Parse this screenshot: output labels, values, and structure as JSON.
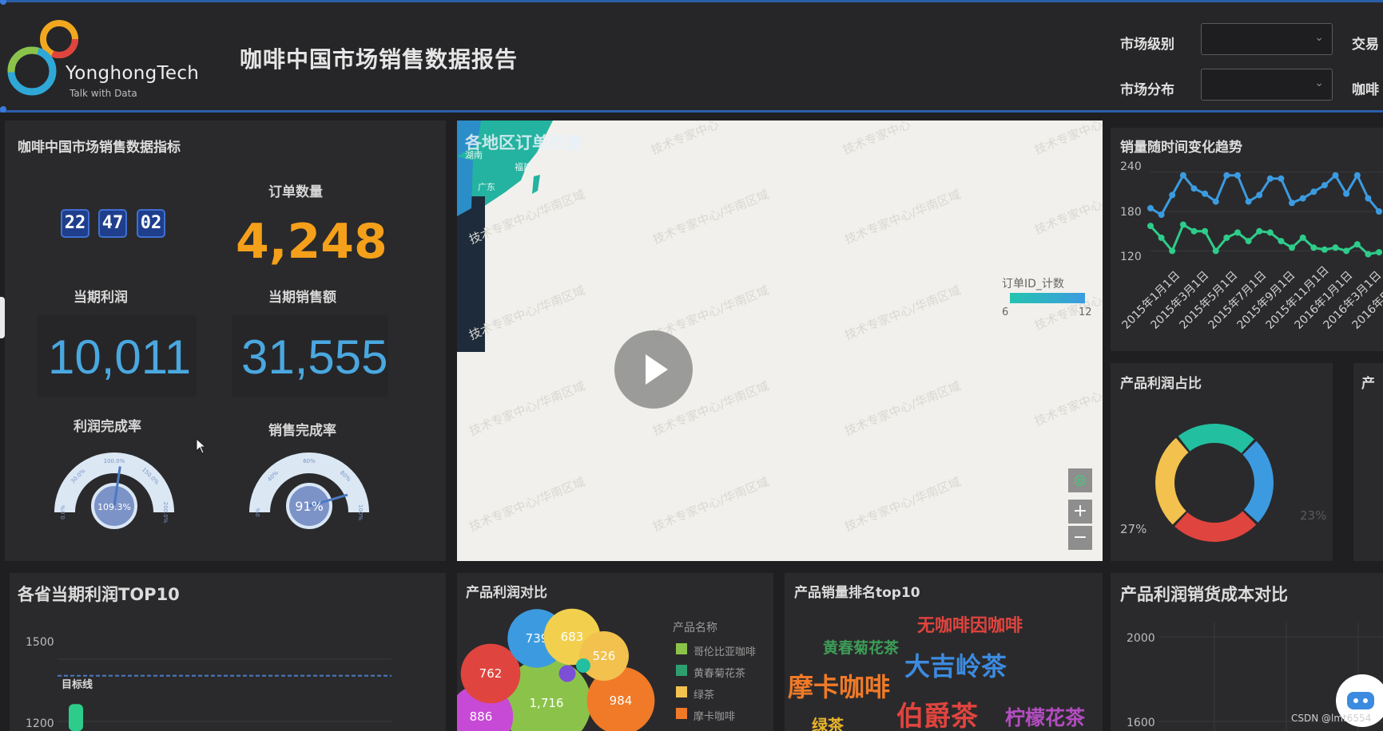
{
  "header": {
    "brand": "YonghongTech",
    "brand_tagline": "Talk with Data",
    "report_title": "咖啡中国市场销售数据报告",
    "filters": [
      {
        "label": "市场级别",
        "value": ""
      },
      {
        "label": "市场分布",
        "value": ""
      }
    ],
    "cut_labels": [
      "交易",
      "咖啡"
    ]
  },
  "kpi_panel": {
    "title": "咖啡中国市场销售数据指标",
    "clock": [
      "22",
      "47",
      "02"
    ],
    "order_count_label": "订单数量",
    "order_count": "4,248",
    "profit_label": "当期利润",
    "profit": "10,011",
    "sales_label": "当期销售额",
    "sales": "31,555",
    "profit_rate_label": "利润完成率",
    "profit_rate": "109.3%",
    "profit_rate_value": 109.3,
    "profit_gauge_ticks": [
      "0.0%",
      "30.0%",
      "100.0%",
      "150.0%",
      "200.0%"
    ],
    "sales_rate_label": "销售完成率",
    "sales_rate": "91%",
    "sales_rate_value": 91,
    "sales_gauge_ticks": [
      "0%",
      "40%",
      "60%",
      "80%",
      "100%"
    ]
  },
  "map_panel": {
    "title": "各地区订单数量",
    "watermark": "技术专家中心/华南区域",
    "watermark_short": "技术专家中心",
    "legend_title": "订单ID_计数",
    "legend_min": "6",
    "legend_max": "12",
    "province_labels": [
      "湖南",
      "广东",
      "福建"
    ],
    "controls": {
      "locate": "◎",
      "zoom_in": "+",
      "zoom_out": "−"
    }
  },
  "trend_panel": {
    "title": "销量随时间变化趋势",
    "y_ticks": [
      "240",
      "180",
      "120"
    ],
    "x_ticks": [
      "2015年1月1日",
      "2015年3月1日",
      "2015年5月1日",
      "2015年7月1日",
      "2015年9月1日",
      "2015年11月1日",
      "2016年1月1日",
      "2016年3月1日",
      "2016年5"
    ]
  },
  "share_panel": {
    "title": "产品利润占比",
    "label_left": "27%",
    "label_right": "23%",
    "next_title": "产"
  },
  "province_panel": {
    "title": "各省当期利润TOP10",
    "y_ticks": [
      "1500",
      "1200"
    ],
    "target_label": "目标线"
  },
  "bubble_panel": {
    "title": "产品利润对比",
    "legend_title": "产品名称",
    "legend": [
      {
        "name": "哥伦比亚咖啡",
        "color": "#8bc34a"
      },
      {
        "name": "黄春菊花茶",
        "color": "#2e9e6e"
      },
      {
        "name": "绿茶",
        "color": "#f2c14e"
      },
      {
        "name": "摩卡咖啡",
        "color": "#f07a28"
      }
    ]
  },
  "wordcloud_panel": {
    "title": "产品销量排名top10",
    "words": [
      {
        "text": "无咖啡因咖啡",
        "color": "#e0443e"
      },
      {
        "text": "黄春菊花茶",
        "color": "#3d9e58"
      },
      {
        "text": "大吉岭茶",
        "color": "#3c8be0"
      },
      {
        "text": "摩卡咖啡",
        "color": "#f07a28"
      },
      {
        "text": "伯爵茶",
        "color": "#e0443e"
      },
      {
        "text": "柠檬花茶",
        "color": "#b24dbf"
      },
      {
        "text": "绿茶",
        "color": "#e8b52c"
      }
    ]
  },
  "cost_panel": {
    "title": "产品利润销货成本对比",
    "y_ticks": [
      "2000",
      "1600"
    ]
  },
  "footer": {
    "credit": "CSDN @lmt6554"
  },
  "chart_data": [
    {
      "type": "line",
      "title": "销量随时间变化趋势",
      "ylim": [
        95,
        265
      ],
      "grid": true,
      "x": [
        "2015年1月1日",
        "",
        "2015年3月1日",
        "",
        "2015年5月1日",
        "",
        "2015年7月1日",
        "",
        "2015年9月1日",
        "",
        "2015年11月1日",
        "",
        "2016年1月1日",
        "",
        "2016年3月1日",
        "",
        "2016年5",
        "",
        "",
        "",
        "",
        ""
      ],
      "series": [
        {
          "values": [
            185,
            175,
            205,
            235,
            215,
            207,
            195,
            235,
            235,
            195,
            205,
            230,
            230,
            193,
            200,
            210,
            220,
            235,
            207,
            235,
            200,
            180
          ],
          "color": "#3c9be0"
        },
        {
          "values": [
            158,
            140,
            120,
            160,
            150,
            150,
            120,
            140,
            148,
            135,
            150,
            148,
            135,
            125,
            140,
            125,
            122,
            125,
            120,
            130,
            115,
            118
          ],
          "color": "#2ecc8a"
        }
      ]
    },
    {
      "type": "pie",
      "title": "产品利润占比",
      "values": [
        27,
        23,
        25,
        25
      ],
      "colors": [
        "#f2c14e",
        "#22c0a0",
        "#3c9be0",
        "#e0443e"
      ]
    },
    {
      "type": "bar",
      "title": "各省当期利润TOP10",
      "ylim": [
        1200,
        1600
      ],
      "target": 1420,
      "values": [
        1230
      ],
      "colors": [
        "#2ecc8a"
      ]
    },
    {
      "type": "scatter",
      "title": "产品利润对比",
      "points": [
        {
          "label": "1,716",
          "value": 1716,
          "color": "#8bc34a"
        },
        {
          "label": "984",
          "value": 984,
          "color": "#f07a28"
        },
        {
          "label": "886",
          "value": 886,
          "color": "#c74ad6"
        },
        {
          "label": "762",
          "value": 762,
          "color": "#e0443e"
        },
        {
          "label": "739",
          "value": 739,
          "color": "#3c9be0"
        },
        {
          "label": "683",
          "value": 683,
          "color": "#f2d04e"
        },
        {
          "label": "526",
          "value": 526,
          "color": "#f2c14e"
        },
        {
          "label": "",
          "value": 60,
          "color": "#7b4fd6"
        },
        {
          "label": "",
          "value": 40,
          "color": "#22c0a0"
        }
      ]
    },
    {
      "type": "bar",
      "title": "产品利润销货成本对比",
      "ylim": [
        1550,
        2050
      ],
      "values": []
    }
  ]
}
